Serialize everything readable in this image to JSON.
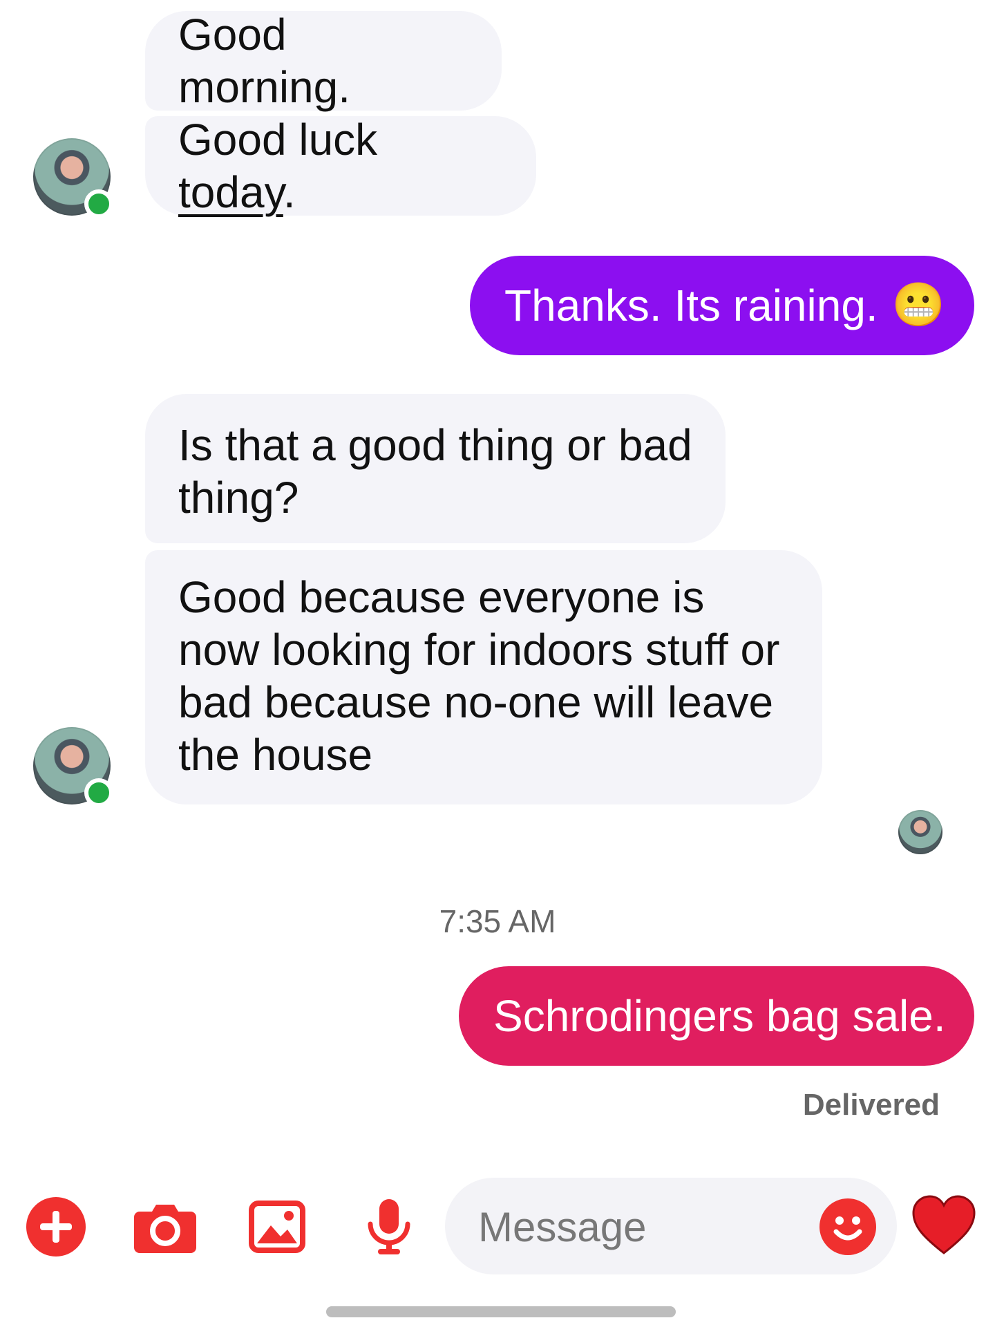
{
  "conversation": {
    "messages": [
      {
        "from": "them",
        "text": "Good morning."
      },
      {
        "from": "them",
        "text_before": "Good luck ",
        "text_link": "today",
        "text_after": "."
      },
      {
        "from": "me",
        "text": "Thanks. Its raining.",
        "emoji": "😬"
      },
      {
        "from": "them",
        "text": "Is that a good thing or bad thing?"
      },
      {
        "from": "them",
        "text": "Good because everyone is now looking for indoors stuff or bad because no-one will leave the house"
      },
      {
        "from": "me",
        "text": "Schrodingers bag sale."
      }
    ],
    "timestamp": "7:35 AM",
    "delivery_status": "Delivered"
  },
  "composer": {
    "placeholder": "Message",
    "icons": [
      "plus-icon",
      "camera-icon",
      "gallery-icon",
      "microphone-icon",
      "emoji-icon",
      "heart-icon"
    ]
  },
  "colors": {
    "incoming_bubble": "#f4f4f9",
    "outgoing_purple": "#8c0ff0",
    "outgoing_red": "#e01e5f",
    "accent": "#f0302f",
    "online": "#22aa44"
  }
}
